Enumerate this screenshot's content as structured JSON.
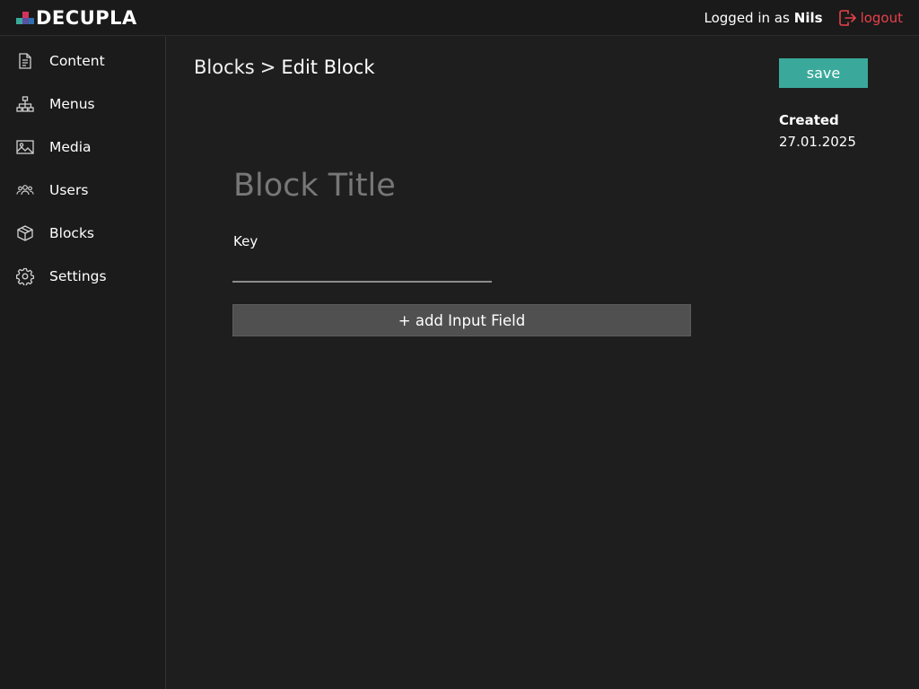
{
  "app": {
    "logo_text": "DECUPLA"
  },
  "header": {
    "logged_in_label": "Logged in as",
    "username": "Nils",
    "logout_label": "logout"
  },
  "sidebar": {
    "items": [
      {
        "label": "Content",
        "icon": "document-icon"
      },
      {
        "label": "Menus",
        "icon": "sitemap-icon"
      },
      {
        "label": "Media",
        "icon": "image-icon"
      },
      {
        "label": "Users",
        "icon": "users-icon"
      },
      {
        "label": "Blocks",
        "icon": "cube-icon"
      },
      {
        "label": "Settings",
        "icon": "gear-icon"
      }
    ]
  },
  "main": {
    "breadcrumb": {
      "parent": "Blocks",
      "separator": ">",
      "current": "Edit Block"
    },
    "title_input": {
      "placeholder": "Block Title",
      "value": ""
    },
    "key_field": {
      "label": "Key",
      "value": ""
    },
    "add_field_label": "+ add Input Field"
  },
  "aside": {
    "save_label": "save",
    "created_label": "Created",
    "created_value": "27.01.2025"
  },
  "colors": {
    "accent": "#3aa99b",
    "logout": "#e8414a",
    "background": "#1e1e1e",
    "sidebar": "#1b1b1b"
  }
}
